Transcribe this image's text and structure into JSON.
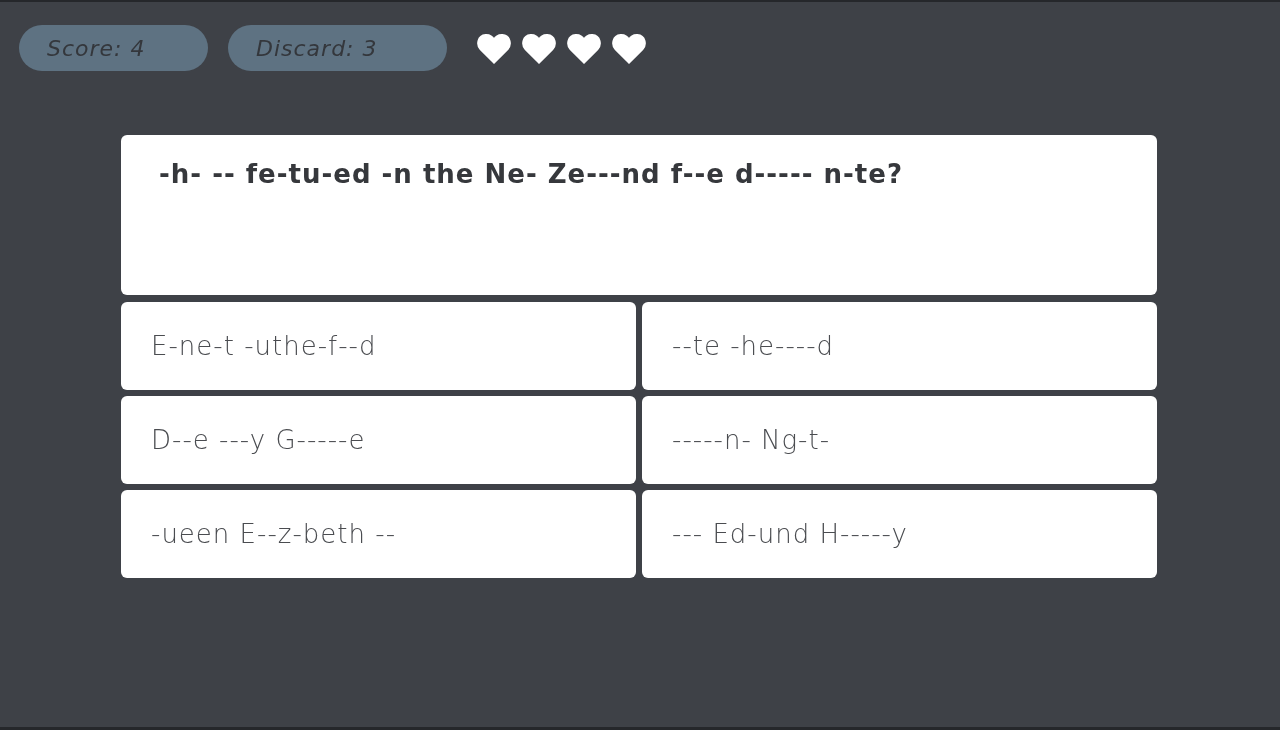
{
  "score_badge": "Score: 4",
  "discard_badge": "Discard: 3",
  "lives": [
    {
      "filled": true
    },
    {
      "filled": true
    },
    {
      "filled": true
    },
    {
      "filled": true
    }
  ],
  "question": "-h- -- fe-tu-ed -n the Ne- Ze---nd f--e d----- n-te?",
  "answers": [
    "E-ne-t -uthe-f--d",
    "--te -he----d",
    "D--e ---y G-----e",
    "-----n- Ng-t-",
    "-ueen E--z-beth --",
    "--- Ed-und H-----y"
  ]
}
